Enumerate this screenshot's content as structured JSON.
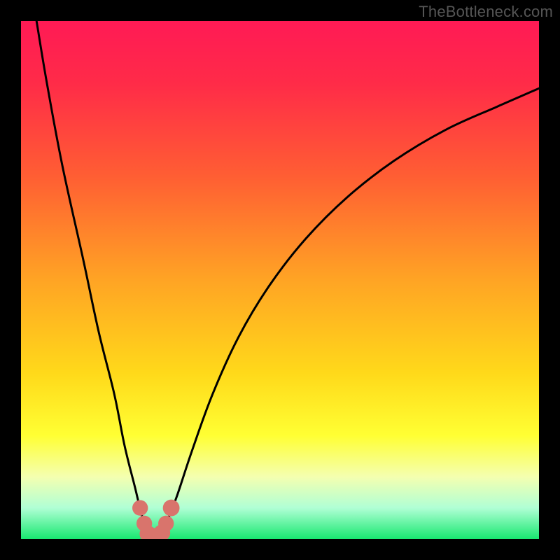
{
  "watermark": "TheBottleneck.com",
  "colors": {
    "background": "#000000",
    "gradient_stops": [
      {
        "offset": 0.0,
        "color": "#ff1a55"
      },
      {
        "offset": 0.12,
        "color": "#ff2b48"
      },
      {
        "offset": 0.3,
        "color": "#ff5e33"
      },
      {
        "offset": 0.5,
        "color": "#ffa424"
      },
      {
        "offset": 0.68,
        "color": "#ffd91a"
      },
      {
        "offset": 0.8,
        "color": "#ffff33"
      },
      {
        "offset": 0.88,
        "color": "#f4ffb0"
      },
      {
        "offset": 0.94,
        "color": "#b0ffd5"
      },
      {
        "offset": 1.0,
        "color": "#18e870"
      }
    ],
    "curve": "#000000",
    "marker_fill": "#d9746c",
    "marker_stroke": "#b85a53"
  },
  "chart_data": {
    "type": "line",
    "title": "",
    "xlabel": "",
    "ylabel": "",
    "xlim": [
      0,
      100
    ],
    "ylim": [
      0,
      100
    ],
    "series": [
      {
        "name": "bottleneck-curve",
        "x": [
          3,
          5,
          8,
          12,
          15,
          18,
          20,
          22,
          23.5,
          25,
          26,
          27,
          28,
          30,
          33,
          37,
          42,
          48,
          55,
          63,
          72,
          82,
          92,
          100
        ],
        "y": [
          100,
          88,
          72,
          54,
          40,
          28,
          18,
          10,
          4,
          1,
          0.5,
          1,
          3,
          8,
          17,
          28,
          39,
          49,
          58,
          66,
          73,
          79,
          83.5,
          87
        ]
      }
    ],
    "markers": {
      "name": "sweet-spot",
      "points": [
        {
          "x": 23.0,
          "y": 6.0,
          "r": 1.4
        },
        {
          "x": 23.8,
          "y": 3.0,
          "r": 1.4
        },
        {
          "x": 24.5,
          "y": 1.0,
          "r": 1.6
        },
        {
          "x": 25.4,
          "y": 0.5,
          "r": 1.6
        },
        {
          "x": 26.3,
          "y": 0.6,
          "r": 1.6
        },
        {
          "x": 27.2,
          "y": 1.2,
          "r": 1.6
        },
        {
          "x": 28.0,
          "y": 3.0,
          "r": 1.4
        },
        {
          "x": 29.0,
          "y": 6.0,
          "r": 1.6
        }
      ]
    }
  }
}
